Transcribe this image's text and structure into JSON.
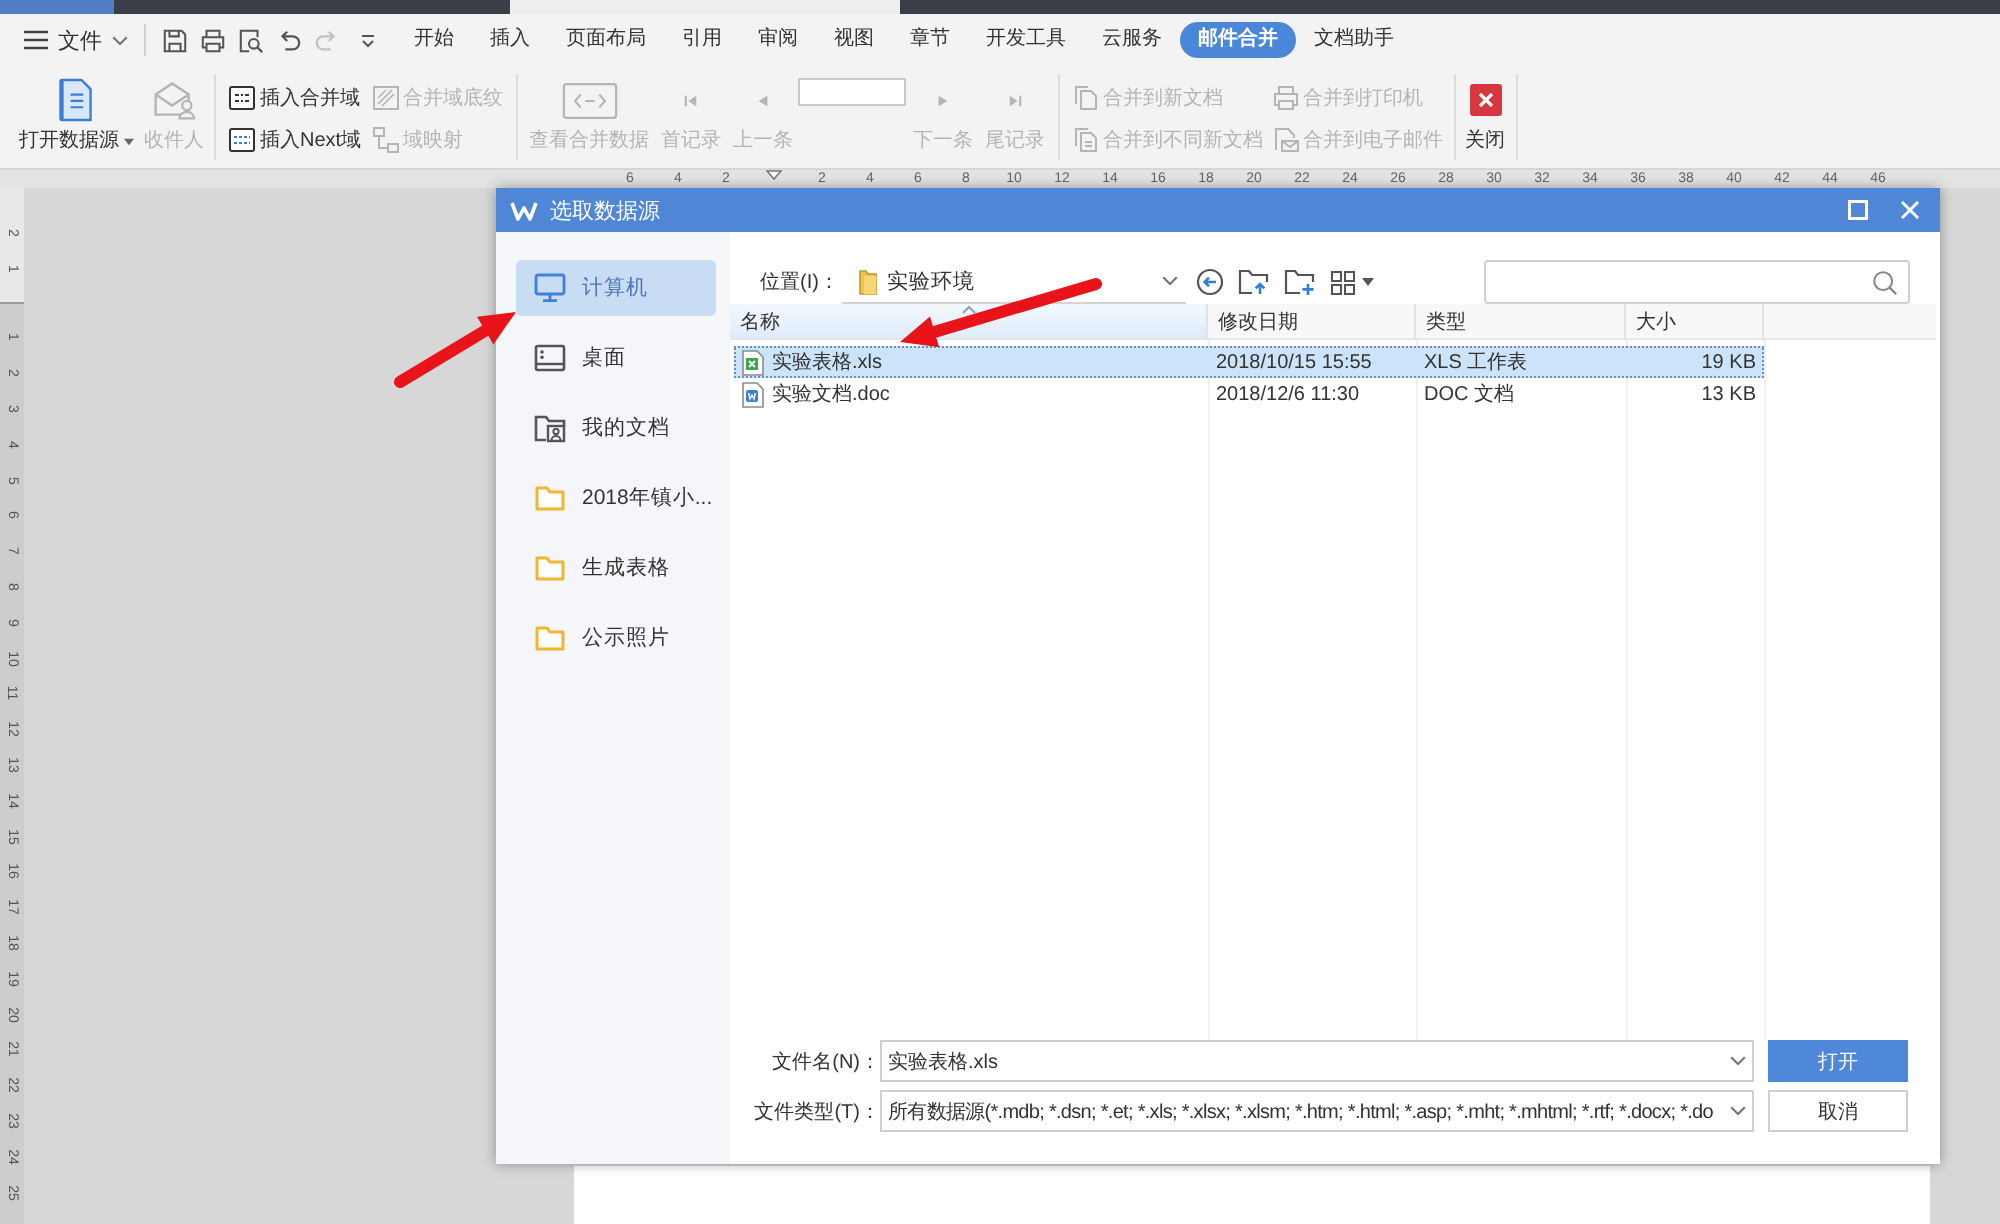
{
  "menu_bar": {
    "file_menu": "文件",
    "quick_access": [
      {
        "kind": "save",
        "disabled": false
      },
      {
        "kind": "print",
        "disabled": false
      },
      {
        "kind": "print_preview",
        "disabled": false
      },
      {
        "kind": "undo",
        "disabled": false
      },
      {
        "kind": "redo",
        "disabled": true
      },
      {
        "kind": "customize",
        "disabled": false
      }
    ],
    "tabs": [
      {
        "label": "开始",
        "selected": false
      },
      {
        "label": "插入",
        "selected": false
      },
      {
        "label": "页面布局",
        "selected": false
      },
      {
        "label": "引用",
        "selected": false
      },
      {
        "label": "审阅",
        "selected": false
      },
      {
        "label": "视图",
        "selected": false
      },
      {
        "label": "章节",
        "selected": false
      },
      {
        "label": "开发工具",
        "selected": false
      },
      {
        "label": "云服务",
        "selected": false
      },
      {
        "label": "邮件合并",
        "selected": true
      },
      {
        "label": "文档助手",
        "selected": false
      }
    ]
  },
  "ribbon": {
    "open_data_source": {
      "label": "打开数据源",
      "disabled": false
    },
    "recipients": {
      "label": "收件人",
      "disabled": true
    },
    "insert_merge_field": {
      "label": "插入合并域",
      "disabled": false
    },
    "insert_next_field": {
      "label": "插入Next域",
      "disabled": false
    },
    "merge_field_shading": {
      "label": "合并域底纹",
      "disabled": true
    },
    "field_mapping": {
      "label": "域映射",
      "disabled": true
    },
    "view_merged_data": {
      "label": "查看合并数据",
      "disabled": true
    },
    "first_record": {
      "label": "首记录",
      "disabled": true
    },
    "previous_record": {
      "label": "上一条",
      "disabled": true
    },
    "next_record": {
      "label": "下一条",
      "disabled": true
    },
    "last_record": {
      "label": "尾记录",
      "disabled": true
    },
    "merge_to_new_document": {
      "label": "合并到新文档",
      "disabled": true
    },
    "merge_to_different_new_documents": {
      "label": "合并到不同新文档",
      "disabled": true
    },
    "merge_to_printer": {
      "label": "合并到打印机",
      "disabled": true
    },
    "merge_to_email": {
      "label": "合并到电子邮件",
      "disabled": true
    },
    "close": {
      "label": "关闭",
      "disabled": false
    }
  },
  "rulers": {
    "top_left_marks": [
      "6",
      "4",
      "2"
    ],
    "top_right_marks": [
      "2",
      "4",
      "6",
      "8",
      "10",
      "12",
      "14",
      "16",
      "18",
      "20",
      "22",
      "24",
      "26",
      "28",
      "30",
      "32",
      "34",
      "36",
      "38",
      "40",
      "42",
      "44",
      "46"
    ],
    "left_top_marks": [
      "2",
      "1"
    ],
    "left_marks": [
      "1",
      "2",
      "3",
      "4",
      "5",
      "6",
      "7",
      "8",
      "9",
      "10",
      "11",
      "12",
      "13",
      "14",
      "15",
      "16",
      "17",
      "18",
      "19",
      "20",
      "21",
      "22",
      "23",
      "24",
      "25"
    ]
  },
  "dialog": {
    "title": "选取数据源",
    "places": [
      {
        "label": "计算机",
        "kind": "computer",
        "selected": true
      },
      {
        "label": "桌面",
        "kind": "desktop",
        "selected": false
      },
      {
        "label": "我的文档",
        "kind": "documents",
        "selected": false
      },
      {
        "label": "2018年镇小...",
        "kind": "folder",
        "selected": false
      },
      {
        "label": "生成表格",
        "kind": "folder",
        "selected": false
      },
      {
        "label": "公示照片",
        "kind": "folder",
        "selected": false
      }
    ],
    "location": {
      "label": "位置(I)：",
      "value": "实验环境"
    },
    "columns": [
      {
        "label": "名称",
        "sorted": true
      },
      {
        "label": "修改日期",
        "sorted": false
      },
      {
        "label": "类型",
        "sorted": false
      },
      {
        "label": "大小",
        "sorted": false
      }
    ],
    "files": [
      {
        "name": "实验表格.xls",
        "kind": "spreadsheet",
        "modified": "2018/10/15 15:55",
        "type": "XLS 工作表",
        "size": "19 KB",
        "selected": true
      },
      {
        "name": "实验文档.doc",
        "kind": "document",
        "modified": "2018/12/6 11:30",
        "type": "DOC 文档",
        "size": "13 KB",
        "selected": false
      }
    ],
    "file_name": {
      "label": "文件名(N)：",
      "value": "实验表格.xls"
    },
    "file_type": {
      "label": "文件类型(T)：",
      "value": "所有数据源(*.mdb; *.dsn; *.et; *.xls; *.xlsx; *.xlsm; *.htm; *.html; *.asp; *.mht; *.mhtml; *.rtf; *.docx; *.do"
    },
    "buttons": [
      {
        "label": "打开",
        "kind": "primary"
      },
      {
        "label": "取消",
        "kind": "secondary"
      }
    ]
  }
}
